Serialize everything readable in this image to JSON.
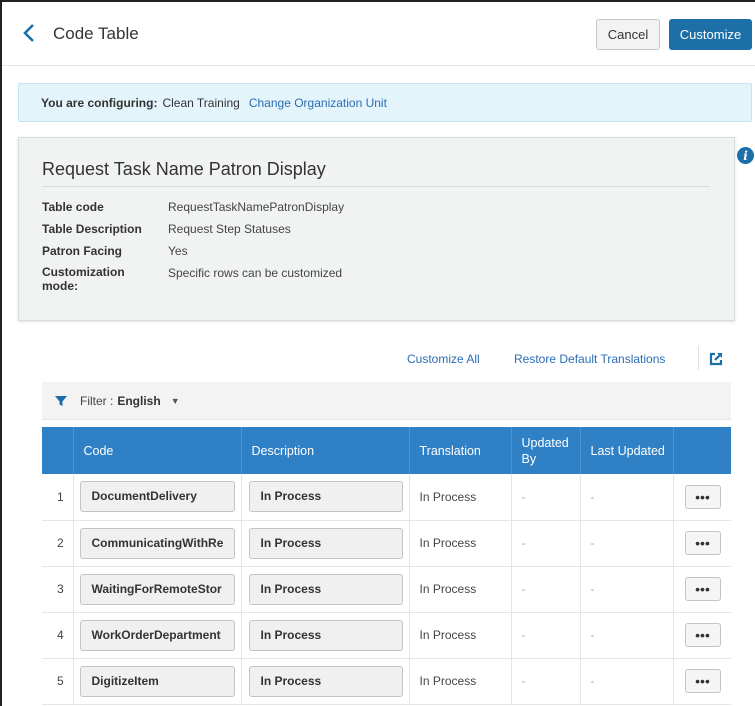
{
  "header": {
    "title": "Code Table",
    "cancel_label": "Cancel",
    "customize_label": "Customize"
  },
  "configuring": {
    "label": "You are configuring:",
    "org": "Clean Training",
    "change_link": "Change Organization Unit"
  },
  "panel": {
    "title": "Request Task Name Patron Display",
    "fields": [
      {
        "label": "Table code",
        "value": "RequestTaskNamePatronDisplay"
      },
      {
        "label": "Table Description",
        "value": "Request Step Statuses"
      },
      {
        "label": "Patron Facing",
        "value": "Yes"
      },
      {
        "label": "Customization mode:",
        "value": "Specific rows can be customized"
      }
    ]
  },
  "actions": {
    "customize_all": "Customize All",
    "restore": "Restore Default Translations"
  },
  "filter": {
    "label": "Filter :",
    "value": "English"
  },
  "table": {
    "columns": [
      "Code",
      "Description",
      "Translation",
      "Updated By",
      "Last Updated"
    ],
    "rows": [
      {
        "num": "1",
        "code": "DocumentDelivery",
        "description": "In Process",
        "translation": "In Process",
        "updated_by": "-",
        "last_updated": "-"
      },
      {
        "num": "2",
        "code": "CommunicatingWithRe",
        "description": "In Process",
        "translation": "In Process",
        "updated_by": "-",
        "last_updated": "-"
      },
      {
        "num": "3",
        "code": "WaitingForRemoteStor",
        "description": "In Process",
        "translation": "In Process",
        "updated_by": "-",
        "last_updated": "-"
      },
      {
        "num": "4",
        "code": "WorkOrderDepartment",
        "description": "In Process",
        "translation": "In Process",
        "updated_by": "-",
        "last_updated": "-"
      },
      {
        "num": "5",
        "code": "DigitizeItem",
        "description": "In Process",
        "translation": "In Process",
        "updated_by": "-",
        "last_updated": "-"
      }
    ],
    "more_label": "•••"
  },
  "icons": {
    "back": "chevron-left-icon",
    "info": "info-icon",
    "filter": "funnel-icon",
    "external": "external-link-icon"
  },
  "colors": {
    "accent": "#1d6fa8",
    "table_header": "#2f80c5",
    "link": "#2a6db4",
    "banner": "#e4f4fb",
    "panel": "#f0f3f2"
  }
}
